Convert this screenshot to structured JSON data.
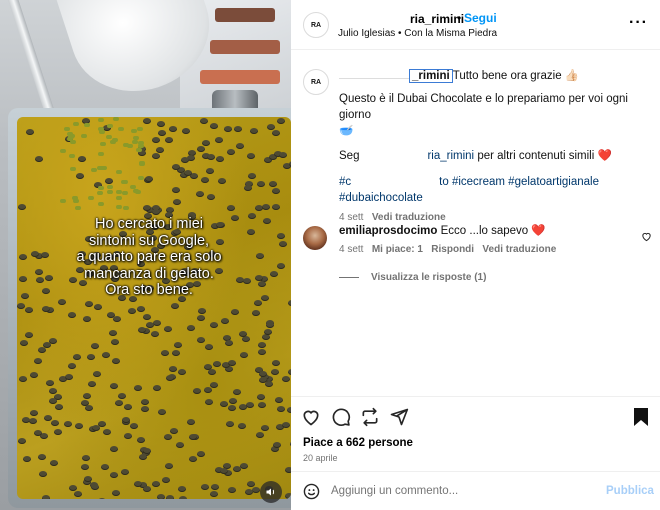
{
  "media": {
    "caption_lines": [
      "Ho cercato i miei",
      "sintomi su Google,",
      "a quanto pare era solo",
      "mancanza di gelato.",
      "Ora sto bene."
    ],
    "mute_icon": "speaker-icon"
  },
  "header": {
    "username_visible": "ria_rimini",
    "separator": "•",
    "follow_label": "Segui",
    "audio": "Julio Iglesias • Con la Misma Piedra",
    "avatar_text": "RA",
    "more_icon": "more-horizontal-icon"
  },
  "post_caption": {
    "mention_visible": "_rimini",
    "line1_rest": "Tutto bene ora grazie 👍🏻",
    "line2": "Questo è il Dubai Chocolate e lo prepariamo per voi ogni giorno",
    "line2_emoji": "🥣",
    "line3_prefix": "Seg",
    "line3_mention_visible": "ria_rimini",
    "line3_suffix": "per altri contenuti simili",
    "line3_emoji": "❤️",
    "hashtags_line1_prefix": "#c",
    "hashtags_line1_visible": "to #icecream #gelatoartigianale",
    "hashtags_line2": "#dubaichocolate",
    "meta_time": "4 sett",
    "meta_translate": "Vedi traduzione"
  },
  "comment": {
    "username": "emiliaprosdocimo",
    "text": "Ecco ...lo sapevo",
    "emoji": "❤️",
    "meta_time": "4 sett",
    "meta_likes": "Mi piace: 1",
    "meta_reply": "Rispondi",
    "meta_translate": "Vedi traduzione",
    "view_replies": "Visualizza le risposte (1)"
  },
  "actions": {
    "likes_text": "Piace a 662 persone",
    "date": "20 aprile"
  },
  "composer": {
    "placeholder": "Aggiungi un commento...",
    "publish_label": "Pubblica"
  }
}
